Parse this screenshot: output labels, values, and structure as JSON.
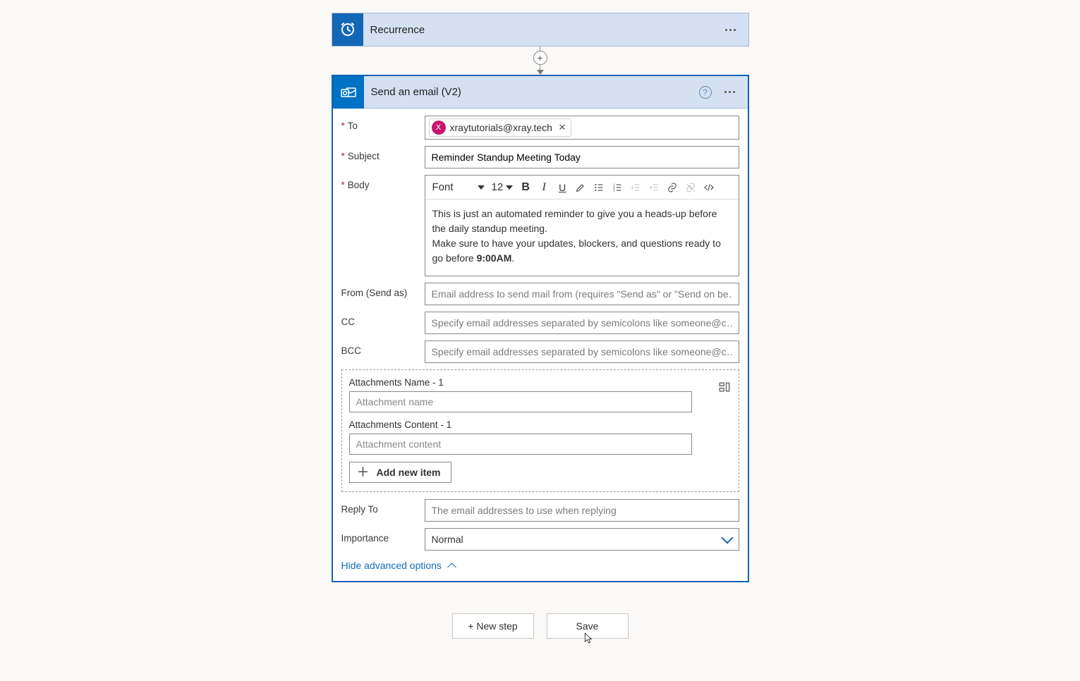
{
  "trigger": {
    "title": "Recurrence"
  },
  "action": {
    "title": "Send an email (V2)"
  },
  "labels": {
    "to": "To",
    "subject": "Subject",
    "body": "Body",
    "from": "From (Send as)",
    "cc": "CC",
    "bcc": "BCC",
    "attach_name": "Attachments Name - 1",
    "attach_content": "Attachments Content - 1",
    "add_new_item": "Add new item",
    "reply_to": "Reply To",
    "importance": "Importance",
    "hide_adv": "Hide advanced options"
  },
  "fields": {
    "to_chip": {
      "avatar_letter": "X",
      "email": "xraytutorials@xray.tech"
    },
    "subject": "Reminder Standup Meeting Today",
    "body_line1": "This is just an automated reminder to give you a heads-up before the daily standup meeting.",
    "body_line2a": "Make sure to have your updates, blockers, and questions ready to go before ",
    "body_line2b": "9:00AM",
    "body_line2c": ".",
    "from_placeholder": "Email address to send mail from (requires \"Send as\" or \"Send on be…",
    "cc_placeholder": "Specify email addresses separated by semicolons like someone@c…",
    "bcc_placeholder": "Specify email addresses separated by semicolons like someone@c…",
    "attach_name_placeholder": "Attachment name",
    "attach_content_placeholder": "Attachment content",
    "reply_to_placeholder": "The email addresses to use when replying",
    "importance_value": "Normal"
  },
  "rt": {
    "font_label": "Font",
    "size_label": "12"
  },
  "buttons": {
    "new_step": "+ New step",
    "save": "Save"
  }
}
